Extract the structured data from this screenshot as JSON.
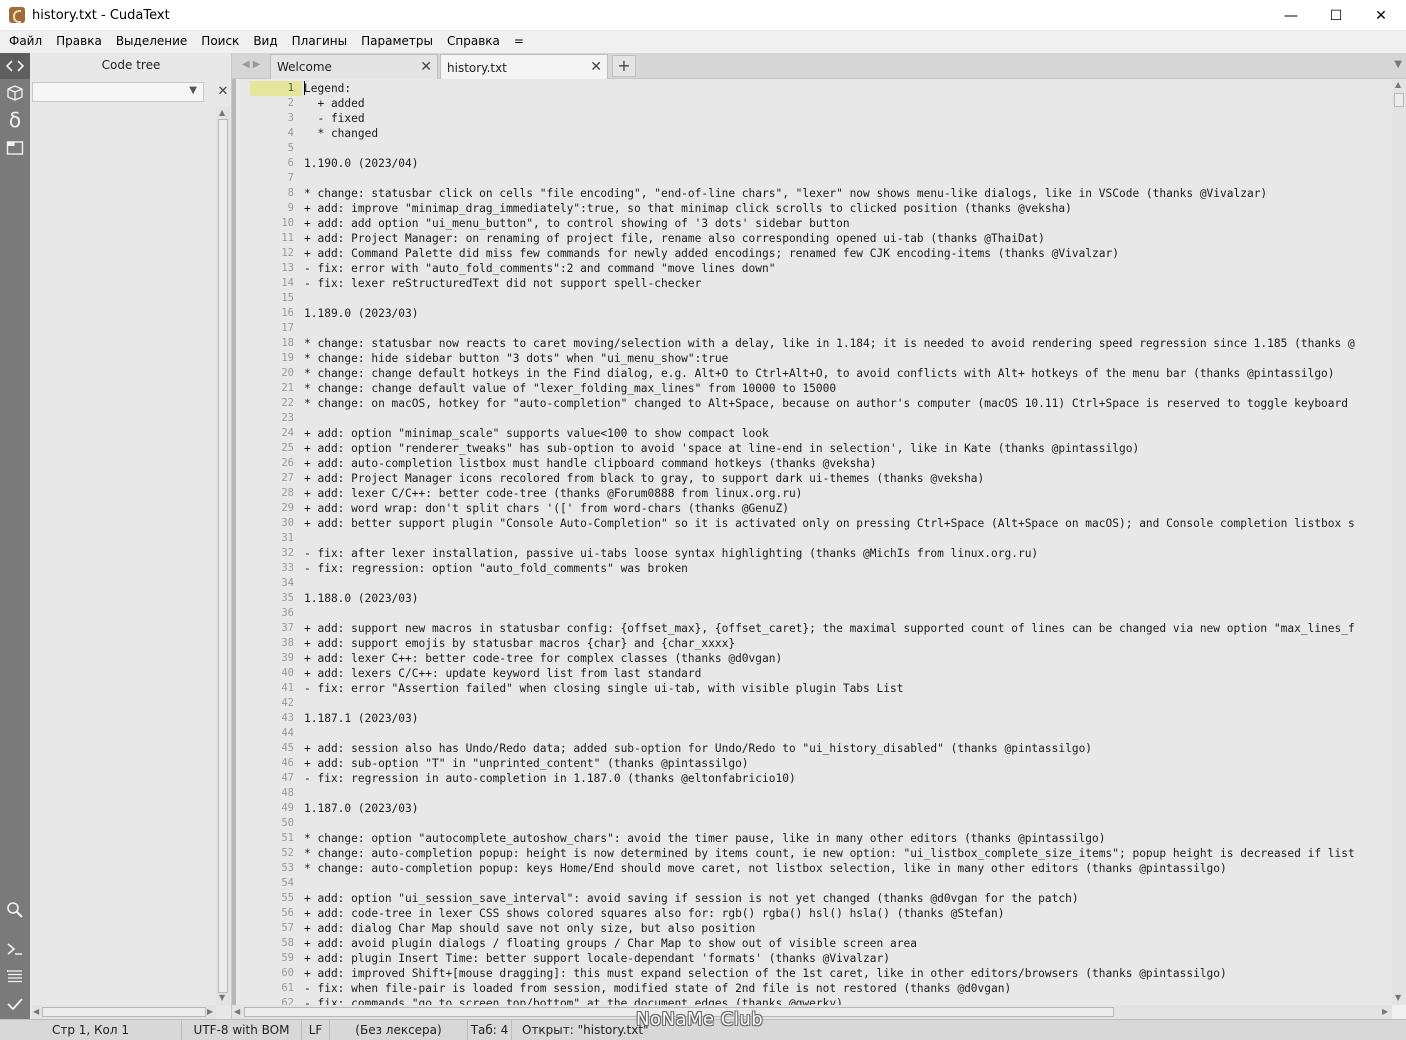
{
  "window": {
    "title": "history.txt - CudaText",
    "minimize": "—",
    "maximize": "☐",
    "close": "✕"
  },
  "menu": [
    "Файл",
    "Правка",
    "Выделение",
    "Поиск",
    "Вид",
    "Плагины",
    "Параметры",
    "Справка",
    "="
  ],
  "sidebar": {
    "icons": [
      "code-tree-icon",
      "project-icon",
      "snippets-icon",
      "tabs-list-icon",
      "search-icon",
      "console-icon",
      "output-icon",
      "validate-icon"
    ],
    "panel_title": "Code tree",
    "close": "✕"
  },
  "tabs": {
    "arrows": "◀▶",
    "items": [
      {
        "label": "Welcome",
        "close": "✕"
      },
      {
        "label": "history.txt",
        "close": "✕"
      }
    ],
    "add": "+",
    "menu": "▼"
  },
  "editor": {
    "current_line": 1,
    "lines": [
      "Legend:",
      "  + added",
      "  - fixed",
      "  * changed",
      "",
      "1.190.0 (2023/04)",
      "",
      "* change: statusbar click on cells \"file encoding\", \"end-of-line chars\", \"lexer\" now shows menu-like dialogs, like in VSCode (thanks @Vivalzar)",
      "+ add: improve \"minimap_drag_immediately\":true, so that minimap click scrolls to clicked position (thanks @veksha)",
      "+ add: add option \"ui_menu_button\", to control showing of '3 dots' sidebar button",
      "+ add: Project Manager: on renaming of project file, rename also corresponding opened ui-tab (thanks @ThaiDat)",
      "+ add: Command Palette did miss few commands for newly added encodings; renamed few CJK encoding-items (thanks @Vivalzar)",
      "- fix: error with \"auto_fold_comments\":2 and command \"move lines down\"",
      "- fix: lexer reStructuredText did not support spell-checker",
      "",
      "1.189.0 (2023/03)",
      "",
      "* change: statusbar now reacts to caret moving/selection with a delay, like in 1.184; it is needed to avoid rendering speed regression since 1.185 (thanks @",
      "* change: hide sidebar button \"3 dots\" when \"ui_menu_show\":true",
      "* change: change default hotkeys in the Find dialog, e.g. Alt+O to Ctrl+Alt+O, to avoid conflicts with Alt+ hotkeys of the menu bar (thanks @pintassilgo)",
      "* change: change default value of \"lexer_folding_max_lines\" from 10000 to 15000",
      "* change: on macOS, hotkey for \"auto-completion\" changed to Alt+Space, because on author's computer (macOS 10.11) Ctrl+Space is reserved to toggle keyboard",
      "",
      "+ add: option \"minimap_scale\" supports value<100 to show compact look",
      "+ add: option \"renderer_tweaks\" has sub-option to avoid 'space at line-end in selection', like in Kate (thanks @pintassilgo)",
      "+ add: auto-completion listbox must handle clipboard command hotkeys (thanks @veksha)",
      "+ add: Project Manager icons recolored from black to gray, to support dark ui-themes (thanks @veksha)",
      "+ add: lexer C/C++: better code-tree (thanks @Forum0888 from linux.org.ru)",
      "+ add: word wrap: don't split chars '([' from word-chars (thanks @GenuZ)",
      "+ add: better support plugin \"Console Auto-Completion\" so it is activated only on pressing Ctrl+Space (Alt+Space on macOS); and Console completion listbox s",
      "",
      "- fix: after lexer installation, passive ui-tabs loose syntax highlighting (thanks @MichIs from linux.org.ru)",
      "- fix: regression: option \"auto_fold_comments\" was broken",
      "",
      "1.188.0 (2023/03)",
      "",
      "+ add: support new macros in statusbar config: {offset_max}, {offset_caret}; the maximal supported count of lines can be changed via new option \"max_lines_f",
      "+ add: support emojis by statusbar macros {char} and {char_xxxx}",
      "+ add: lexer C++: better code-tree for complex classes (thanks @d0vgan)",
      "+ add: lexers C/C++: update keyword list from last standard",
      "- fix: error \"Assertion failed\" when closing single ui-tab, with visible plugin Tabs List",
      "",
      "1.187.1 (2023/03)",
      "",
      "+ add: session also has Undo/Redo data; added sub-option for Undo/Redo to \"ui_history_disabled\" (thanks @pintassilgo)",
      "+ add: sub-option \"T\" in \"unprinted_content\" (thanks @pintassilgo)",
      "- fix: regression in auto-completion in 1.187.0 (thanks @eltonfabricio10)",
      "",
      "1.187.0 (2023/03)",
      "",
      "* change: option \"autocomplete_autoshow_chars\": avoid the timer pause, like in many other editors (thanks @pintassilgo)",
      "* change: auto-completion popup: height is now determined by items count, ie new option: \"ui_listbox_complete_size_items\"; popup height is decreased if list",
      "* change: auto-completion popup: keys Home/End should move caret, not listbox selection, like in many other editors (thanks @pintassilgo)",
      "",
      "+ add: option \"ui_session_save_interval\": avoid saving if session is not yet changed (thanks @d0vgan for the patch)",
      "+ add: code-tree in lexer CSS shows colored squares also for: rgb() rgba() hsl() hsla() (thanks @Stefan)",
      "+ add: dialog Char Map should save not only size, but also position",
      "+ add: avoid plugin dialogs / floating groups / Char Map to show out of visible screen area",
      "+ add: plugin Insert Time: better support locale-dependant 'formats' (thanks @Vivalzar)",
      "+ add: improved Shift+[mouse dragging]: this must expand selection of the 1st caret, like in other editors/browsers (thanks @pintassilgo)",
      "- fix: when file-pair is loaded from session, modified state of 2nd file is not restored (thanks @d0vgan)",
      "- fix: commands \"go to screen top/bottom\" at the document edges (thanks @qwerky)"
    ]
  },
  "statusbar": {
    "position": "Стр 1, Кол 1",
    "encoding": "UTF-8 with BOM",
    "line_ending": "LF",
    "lexer": "(Без лексера)",
    "tab": "Таб: 4",
    "message": "Открыт: \"history.txt\""
  },
  "watermark": "NoNaMe Club"
}
